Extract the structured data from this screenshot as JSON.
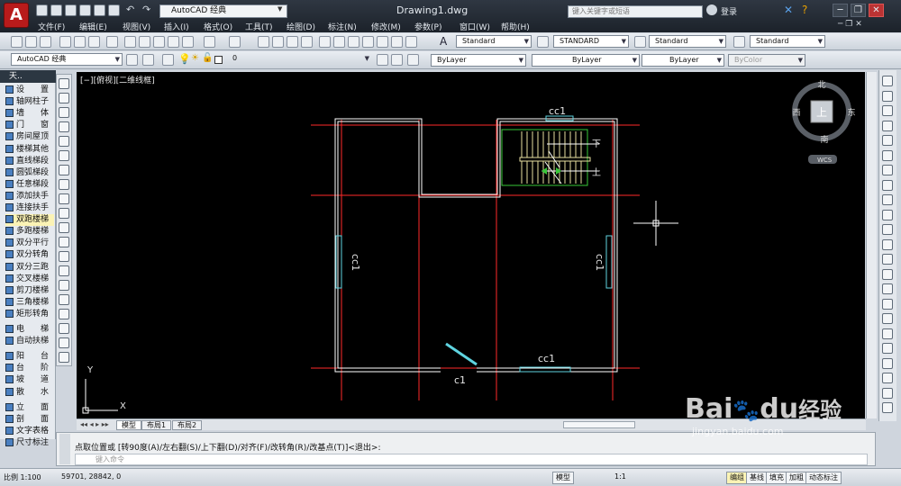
{
  "app": {
    "logo": "A",
    "workspace": "AutoCAD 经典",
    "doc_title": "Drawing1.dwg",
    "search_placeholder": "键入关键字或短语",
    "login": "登录",
    "window_controls": [
      "─",
      "❐",
      "✕"
    ]
  },
  "menu": [
    "文件(F)",
    "编辑(E)",
    "视图(V)",
    "插入(I)",
    "格式(O)",
    "工具(T)",
    "绘图(D)",
    "标注(N)",
    "修改(M)",
    "参数(P)",
    "窗口(W)",
    "帮助(H)"
  ],
  "styles": {
    "text_style": "Standard",
    "dim_style": "STANDARD",
    "table_style": "Standard",
    "multileader_style": "Standard"
  },
  "layers": {
    "workspace2": "AutoCAD 经典",
    "current_layer": "0",
    "color": "ByLayer",
    "linetype": "ByLayer",
    "lineweight": "ByLayer",
    "plotstyle": "ByColor"
  },
  "palette": {
    "title": "天..",
    "items": [
      {
        "label": "设　　置",
        "selected": false
      },
      {
        "label": "轴网柱子",
        "selected": false
      },
      {
        "label": "墙　　体",
        "selected": false
      },
      {
        "label": "门　　窗",
        "selected": false
      },
      {
        "label": "房间屋顶",
        "selected": false
      },
      {
        "label": "楼梯其他",
        "selected": false
      },
      {
        "label": "直线梯段",
        "selected": false
      },
      {
        "label": "圆弧梯段",
        "selected": false
      },
      {
        "label": "任意梯段",
        "selected": false
      },
      {
        "label": "添加扶手",
        "selected": false
      },
      {
        "label": "连接扶手",
        "selected": false
      },
      {
        "label": "双跑楼梯",
        "selected": true
      },
      {
        "label": "多跑楼梯",
        "selected": false
      },
      {
        "label": "双分平行",
        "selected": false
      },
      {
        "label": "双分转角",
        "selected": false
      },
      {
        "label": "双分三跑",
        "selected": false
      },
      {
        "label": "交叉楼梯",
        "selected": false
      },
      {
        "label": "剪刀楼梯",
        "selected": false
      },
      {
        "label": "三角楼梯",
        "selected": false
      },
      {
        "label": "矩形转角",
        "selected": false
      },
      {
        "label": "电　　梯",
        "selected": false
      },
      {
        "label": "自动扶梯",
        "selected": false
      },
      {
        "label": "阳　　台",
        "selected": false
      },
      {
        "label": "台　　阶",
        "selected": false
      },
      {
        "label": "坡　　道",
        "selected": false
      },
      {
        "label": "散　　水",
        "selected": false
      },
      {
        "label": "立　　面",
        "selected": false
      },
      {
        "label": "剖　　面",
        "selected": false
      },
      {
        "label": "文字表格",
        "selected": false
      },
      {
        "label": "尺寸标注",
        "selected": false
      }
    ]
  },
  "viewport": {
    "label": "[−][俯视][二维线框]",
    "compass": {
      "north": "北",
      "south": "南",
      "east": "东",
      "west": "西",
      "top": "上"
    },
    "wcs": "WCS",
    "ucs_x": "X",
    "ucs_y": "Y"
  },
  "drawing": {
    "labels": {
      "top_window": "cc1",
      "left_window": "cc1",
      "right_window": "cc1",
      "bottom_window": "cc1",
      "door": "c1",
      "down": "下",
      "up": "上"
    }
  },
  "tabs": [
    "模型",
    "布局1",
    "布局2"
  ],
  "command": {
    "prompt": "点取位置或 [转90度(A)/左右翻(S)/上下翻(D)/对齐(F)/改转角(R)/改基点(T)]<退出>:",
    "input_placeholder": "键入命令"
  },
  "status": {
    "scale": "比例 1:100",
    "coords": "59701, 28842, 0",
    "model": "模型",
    "anno_scale": "1:1",
    "buttons": [
      "编组",
      "基线",
      "填充",
      "加粗",
      "动态标注"
    ]
  },
  "watermark": {
    "brand": "Bai",
    "brand2": "du",
    "jing": "经验",
    "url": "jingyan.baidu.com"
  },
  "colors": {
    "accent": "#b81b1b",
    "grid_red": "#ff2a2a",
    "wall": "#ffffff",
    "window_cyan": "#5fd4e0",
    "stair_green": "#39c739",
    "stair_yellow": "#e9e1a0"
  }
}
